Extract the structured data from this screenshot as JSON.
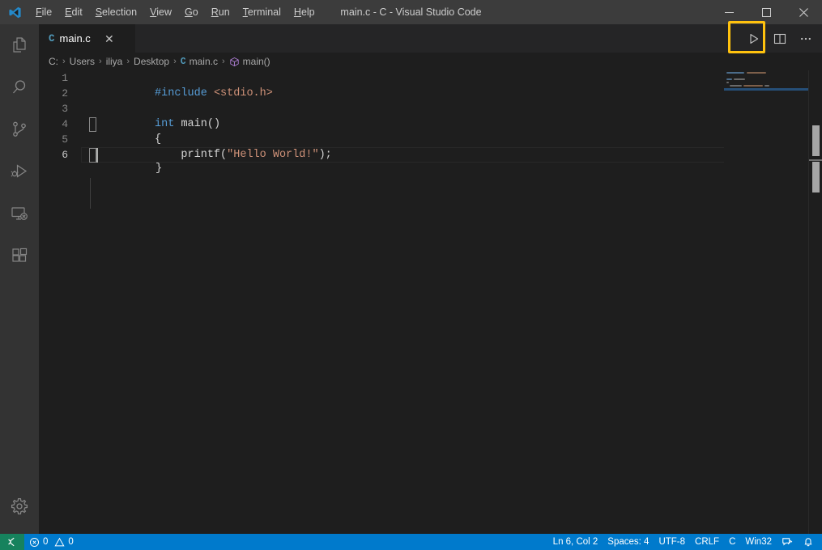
{
  "window": {
    "title": "main.c - C - Visual Studio Code",
    "logo_icon": "vscode-logo-icon",
    "controls": {
      "minimize": "—",
      "maximize": "□",
      "close": "✕"
    }
  },
  "menubar": {
    "items": [
      {
        "label": "File",
        "mnemonic": "F"
      },
      {
        "label": "Edit",
        "mnemonic": "E"
      },
      {
        "label": "Selection",
        "mnemonic": "S"
      },
      {
        "label": "View",
        "mnemonic": "V"
      },
      {
        "label": "Go",
        "mnemonic": "G"
      },
      {
        "label": "Run",
        "mnemonic": "R"
      },
      {
        "label": "Terminal",
        "mnemonic": "T"
      },
      {
        "label": "Help",
        "mnemonic": "H"
      }
    ]
  },
  "activitybar": {
    "items": [
      {
        "name": "explorer",
        "icon": "files-icon"
      },
      {
        "name": "search",
        "icon": "search-icon"
      },
      {
        "name": "source-control",
        "icon": "source-control-icon"
      },
      {
        "name": "run-and-debug",
        "icon": "run-debug-icon"
      },
      {
        "name": "remote-explorer",
        "icon": "remote-explorer-icon"
      },
      {
        "name": "extensions",
        "icon": "extensions-icon"
      }
    ],
    "bottom": [
      {
        "name": "manage",
        "icon": "gear-icon"
      }
    ]
  },
  "tabs": {
    "open": [
      {
        "file_icon": "C",
        "label": "main.c",
        "close_icon": "✕",
        "active": true
      }
    ],
    "actions": [
      {
        "name": "run-code",
        "icon": "play-icon",
        "highlighted": true
      },
      {
        "name": "split-editor",
        "icon": "split-editor-icon",
        "highlighted": false
      },
      {
        "name": "more-actions",
        "icon": "ellipsis-icon",
        "highlighted": false
      }
    ]
  },
  "breadcrumb": {
    "separator": "›",
    "items": [
      {
        "label": "C:",
        "icon": ""
      },
      {
        "label": "Users",
        "icon": ""
      },
      {
        "label": "iliya",
        "icon": ""
      },
      {
        "label": "Desktop",
        "icon": ""
      },
      {
        "label": "main.c",
        "icon": "c-file-icon"
      },
      {
        "label": "main()",
        "icon": "symbol-function-icon"
      }
    ]
  },
  "editor": {
    "language": "C",
    "lines": [
      {
        "number": "1",
        "tokens": [
          {
            "text": "#include",
            "type": "pre"
          },
          {
            "text": " ",
            "type": "plain"
          },
          {
            "text": "<stdio.h>",
            "type": "str"
          }
        ]
      },
      {
        "number": "2",
        "tokens": []
      },
      {
        "number": "3",
        "tokens": [
          {
            "text": "int",
            "type": "kw"
          },
          {
            "text": " ",
            "type": "plain"
          },
          {
            "text": "main",
            "type": "id"
          },
          {
            "text": "()",
            "type": "punc"
          }
        ]
      },
      {
        "number": "4",
        "tokens": [
          {
            "text": "{",
            "type": "punc"
          }
        ]
      },
      {
        "number": "5",
        "tokens": [
          {
            "text": "    ",
            "type": "plain"
          },
          {
            "text": "printf",
            "type": "id"
          },
          {
            "text": "(",
            "type": "punc"
          },
          {
            "text": "\"Hello World!\"",
            "type": "str"
          },
          {
            "text": ");",
            "type": "punc"
          }
        ]
      },
      {
        "number": "6",
        "tokens": [
          {
            "text": "}",
            "type": "punc"
          }
        ],
        "current": true
      }
    ],
    "cursor": {
      "line": 6,
      "column": 2
    }
  },
  "statusbar": {
    "remote_icon": "remote-host-icon",
    "left": [
      {
        "name": "errors",
        "icon": "error-icon",
        "value": "0"
      },
      {
        "name": "warnings",
        "icon": "warning-icon",
        "value": "0"
      }
    ],
    "right": [
      {
        "name": "cursor-position",
        "label": "Ln 6, Col 2"
      },
      {
        "name": "indentation",
        "label": "Spaces: 4"
      },
      {
        "name": "encoding",
        "label": "UTF-8"
      },
      {
        "name": "eol",
        "label": "CRLF"
      },
      {
        "name": "language-mode",
        "label": "C"
      },
      {
        "name": "platform",
        "label": "Win32"
      }
    ],
    "right_icons": [
      {
        "name": "feedback",
        "icon": "feedback-icon"
      },
      {
        "name": "notifications",
        "icon": "bell-icon"
      }
    ]
  },
  "colors": {
    "titlebar_bg": "#3c3c3c",
    "activitybar_bg": "#333333",
    "editor_bg": "#1e1e1e",
    "tabs_bg": "#252526",
    "statusbar_bg": "#007acc",
    "remote_bg": "#16825d",
    "highlight_box": "#ffc20e",
    "accent_blue": "#569cd6",
    "string_orange": "#ce9178",
    "file_icon_blue": "#519aba",
    "symbol_purple": "#b180d7"
  }
}
